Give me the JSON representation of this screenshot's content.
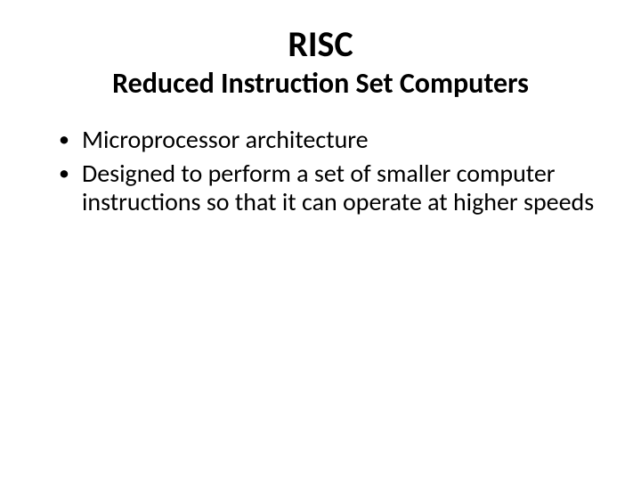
{
  "title": "RISC",
  "subtitle": "Reduced Instruction Set Computers",
  "bullets": [
    "Microprocessor architecture",
    "Designed to perform a set of smaller computer instructions so that it can operate at higher speeds"
  ]
}
